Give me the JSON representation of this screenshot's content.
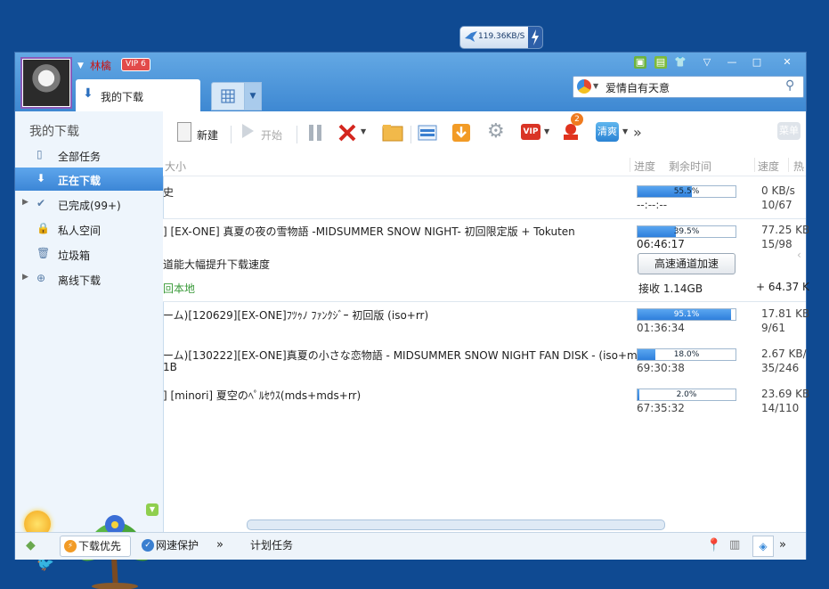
{
  "speed_widget": {
    "value": "119.36KB/S"
  },
  "titlebar": {
    "username": "林檎",
    "vip_label": "VIP 6",
    "tab_label": "我的下载",
    "search_text": "爱情自有天意",
    "controls": [
      "▽",
      "—",
      "□",
      "✕"
    ]
  },
  "sidebar": {
    "title": "我的下载",
    "items": [
      {
        "label": "全部任务"
      },
      {
        "label": "正在下载"
      },
      {
        "label": "已完成(99+)"
      },
      {
        "label": "私人空间"
      },
      {
        "label": "垃圾箱"
      },
      {
        "label": "离线下载"
      }
    ]
  },
  "toolbar": {
    "new_label": "新建",
    "start_label": "开始",
    "vip_label": "VIP",
    "clean_label": "清爽",
    "badge_count": "2",
    "more": "»",
    "menu_label": "菜单"
  },
  "header": {
    "size": "大小",
    "progress": "进度",
    "remaining": "剩余时间",
    "speed": "速度",
    "hot": "热"
  },
  "rows": [
    {
      "name": "史",
      "progress_text": "55.5%",
      "progress": 0.555,
      "remaining": "--:--:--",
      "speed": "0 KB/s",
      "peers": "10/67"
    },
    {
      "name": "] [EX-ONE] 真夏の夜の雪物語 -MIDSUMMER SNOW NIGHT- 初回限定版 + Tokuten",
      "progress_text": "39.5%",
      "progress": 0.395,
      "remaining": "06:46:17",
      "speed": "77.25 KB",
      "peers": "15/98",
      "hs_note": "道能大幅提升下载速度",
      "hs_button": "高速通道加速",
      "save_local": "回本地",
      "received": "接收 1.14GB",
      "received_delta": "+ 64.37 K"
    },
    {
      "name": "ーム)[120629][EX-ONE]ﾌﾂｩﾉ ﾌｧﾝｸｼﾞｰ 初回版 (iso+rr)",
      "progress_text": "95.1%",
      "progress": 0.951,
      "remaining": "01:36:34",
      "speed": "17.81 KB",
      "peers": "9/61"
    },
    {
      "name": "ーム)[130222][EX-ONE]真夏の小さな恋物語 - MIDSUMMER SNOW NIGHT FAN DISK - (iso+mds…",
      "size": "1B",
      "progress_text": "18.0%",
      "progress": 0.18,
      "remaining": "69:30:38",
      "speed": "2.67 KB/",
      "peers": "35/246"
    },
    {
      "name": "] [minori] 夏空のﾍﾟﾙｾｳｽ(mds+mds+rr)",
      "progress_text": "2.0%",
      "progress": 0.02,
      "remaining": "67:35:32",
      "speed": "23.69 KB",
      "peers": "14/110"
    }
  ],
  "statusbar": {
    "priority_label": "下载优先",
    "protect_label": "网速保护",
    "more": "»",
    "schedule_label": "计划任务",
    "more_right": "»"
  }
}
